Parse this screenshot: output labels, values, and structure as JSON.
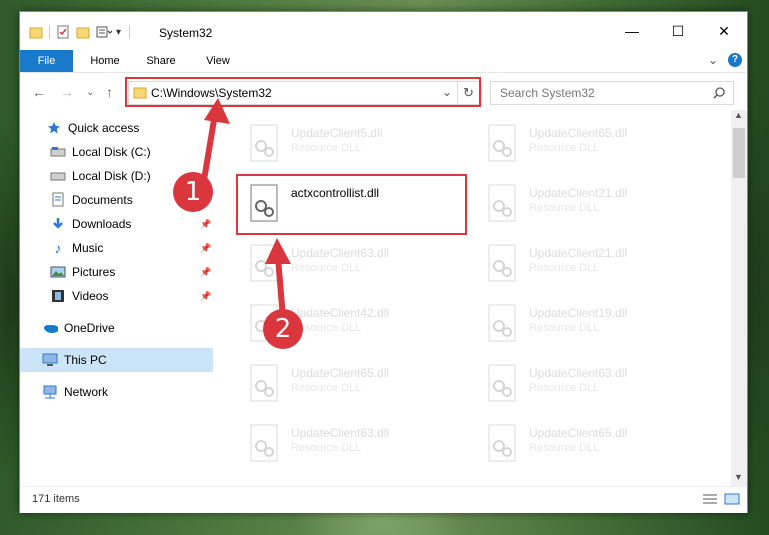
{
  "window": {
    "title": "System32"
  },
  "titlebar": {
    "minimize_glyph": "—",
    "maximize_glyph": "☐",
    "close_glyph": "✕"
  },
  "ribbon": {
    "tabs": [
      "File",
      "Home",
      "Share",
      "View"
    ],
    "collapse_glyph": "⌄",
    "help_glyph": "?"
  },
  "address": {
    "path": "C:\\Windows\\System32",
    "search_placeholder": "Search System32"
  },
  "sidebar": {
    "items": [
      {
        "label": "Quick access",
        "icon": "star-icon"
      },
      {
        "label": "Local Disk (C:)",
        "icon": "drive-icon"
      },
      {
        "label": "Local Disk (D:)",
        "icon": "drive-icon"
      },
      {
        "label": "Documents",
        "icon": "documents-icon"
      },
      {
        "label": "Downloads",
        "icon": "download-icon"
      },
      {
        "label": "Music",
        "icon": "music-icon"
      },
      {
        "label": "Pictures",
        "icon": "pictures-icon"
      },
      {
        "label": "Videos",
        "icon": "videos-icon"
      },
      {
        "label": "OneDrive",
        "icon": "cloud-icon"
      },
      {
        "label": "This PC",
        "icon": "computer-icon"
      },
      {
        "label": "Network",
        "icon": "network-icon"
      }
    ]
  },
  "files": {
    "selected": {
      "name": "actxcontrollist.dll"
    },
    "left": [
      {
        "name": "UpdateClient5.dll",
        "type": "Resource DLL"
      },
      {
        "name": "UpdateClient63.dll",
        "type": "Resource DLL"
      },
      {
        "name": "UpdateClient42.dll",
        "type": "Resource DLL"
      },
      {
        "name": "UpdateClient65.dll",
        "type": "Resource DLL"
      },
      {
        "name": "UpdateClient63.dll",
        "type": "Resource DLL"
      }
    ],
    "right": [
      {
        "name": "UpdateClient65.dll",
        "type": "Resource DLL"
      },
      {
        "name": "UpdateClient21.dll",
        "type": "Resource DLL"
      },
      {
        "name": "UpdateClient21.dll",
        "type": "Resource DLL"
      },
      {
        "name": "UpdateClient19.dll",
        "type": "Resource DLL"
      },
      {
        "name": "UpdateClient63.dll",
        "type": "Resource DLL"
      },
      {
        "name": "UpdateClient65.dll",
        "type": "Resource DLL"
      }
    ]
  },
  "status": {
    "count": "171 items"
  },
  "annotations": {
    "step1": "1",
    "step2": "2",
    "color": "#d9363e"
  }
}
